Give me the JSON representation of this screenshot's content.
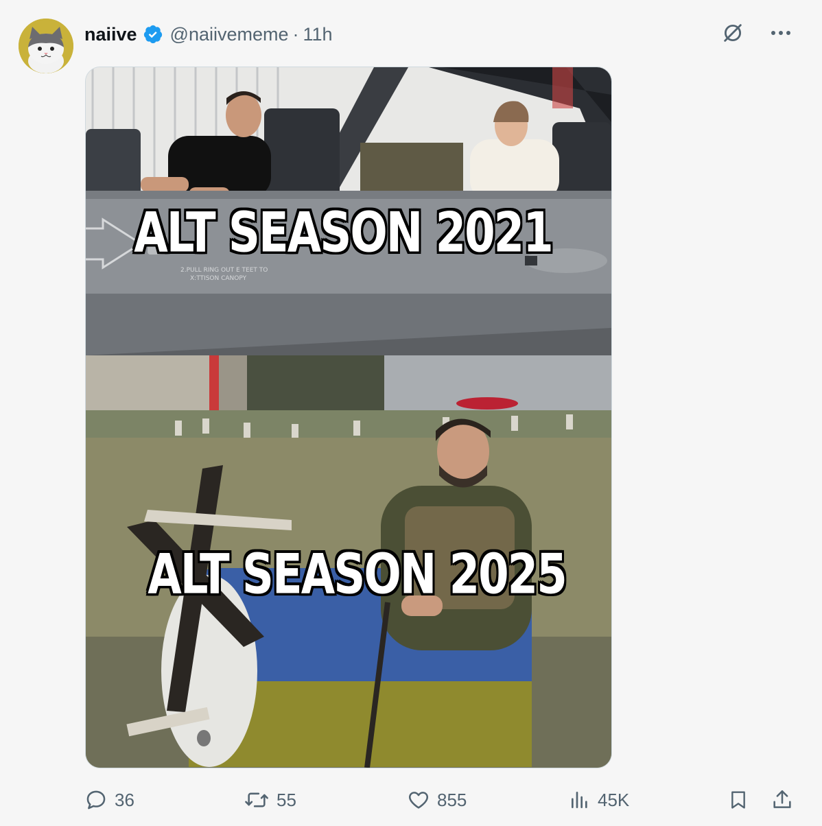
{
  "post": {
    "display_name": "naiive",
    "handle": "@naiivememe",
    "separator": "·",
    "time": "11h"
  },
  "meme": {
    "top_caption": "ALT SEASON 2021",
    "bottom_caption": "ALT SEASON 2025",
    "aircraft_stenciling": [
      "2.PULL RING OUT E TEET TO",
      "X:TTISON CANOPY"
    ]
  },
  "stats": {
    "replies": "36",
    "reposts": "55",
    "likes": "855",
    "views": "45K"
  },
  "icons": {
    "verified": "verified-badge-icon",
    "grok": "grok-icon",
    "more": "more-icon",
    "reply": "reply-icon",
    "repost": "repost-icon",
    "like": "heart-icon",
    "views": "views-icon",
    "bookmark": "bookmark-icon",
    "share": "share-icon"
  },
  "colors": {
    "accent": "#1d9bf0",
    "muted": "#536471",
    "avatar_bg": "#c9b23a"
  }
}
